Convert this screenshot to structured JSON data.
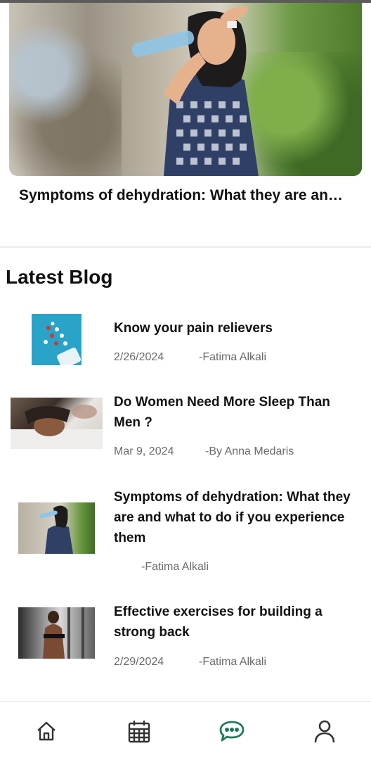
{
  "hero": {
    "title": "Symptoms of dehydration: What they are an…"
  },
  "latest_blog": {
    "heading": "Latest Blog",
    "items": [
      {
        "title": " Know your pain relievers",
        "date": "2/26/2024",
        "author": "-Fatima Alkali"
      },
      {
        "title": "Do Women Need More Sleep Than Men ?",
        "date": "Mar 9, 2024",
        "author": "-By Anna Medaris"
      },
      {
        "title": "Symptoms of dehydration: What they are and what to do if you experience them",
        "date": "",
        "author": "-Fatima Alkali"
      },
      {
        "title": "Effective exercises for building a strong back",
        "date": "2/29/2024",
        "author": "-Fatima Alkali"
      }
    ]
  },
  "bottom_nav": {
    "active": "chat",
    "accent_color": "#1e7a5a",
    "icons": [
      "home-icon",
      "calendar-icon",
      "chat-icon",
      "profile-icon"
    ]
  },
  "colors": {
    "meta_text": "#6b6b6b",
    "divider": "#ececec"
  }
}
